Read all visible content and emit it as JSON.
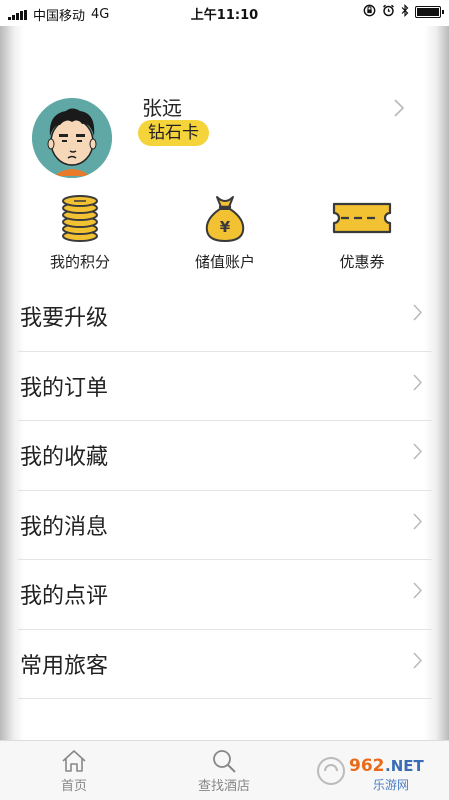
{
  "status_bar": {
    "carrier": "中国移动",
    "network": "4G",
    "time": "上午11:10"
  },
  "profile": {
    "name": "张远",
    "member_level": "钻石卡"
  },
  "quick_actions": [
    {
      "label": "我的积分",
      "icon": "coin-stack-icon"
    },
    {
      "label": "储值账户",
      "icon": "money-bag-icon"
    },
    {
      "label": "优惠券",
      "icon": "coupon-icon"
    }
  ],
  "menu": [
    {
      "label": "我要升级"
    },
    {
      "label": "我的订单"
    },
    {
      "label": "我的收藏"
    },
    {
      "label": "我的消息"
    },
    {
      "label": "我的点评"
    },
    {
      "label": "常用旅客"
    }
  ],
  "tab_bar": [
    {
      "label": "首页",
      "icon": "home-icon"
    },
    {
      "label": "查找酒店",
      "icon": "search-icon"
    }
  ],
  "watermark": {
    "text_top": "962.NET",
    "text_bottom": "乐游网"
  },
  "colors": {
    "accent_yellow": "#f5d33b",
    "icon_yellow": "#f2c233",
    "icon_outline": "#3a3a3a",
    "chevron": "#b9b9b9"
  }
}
